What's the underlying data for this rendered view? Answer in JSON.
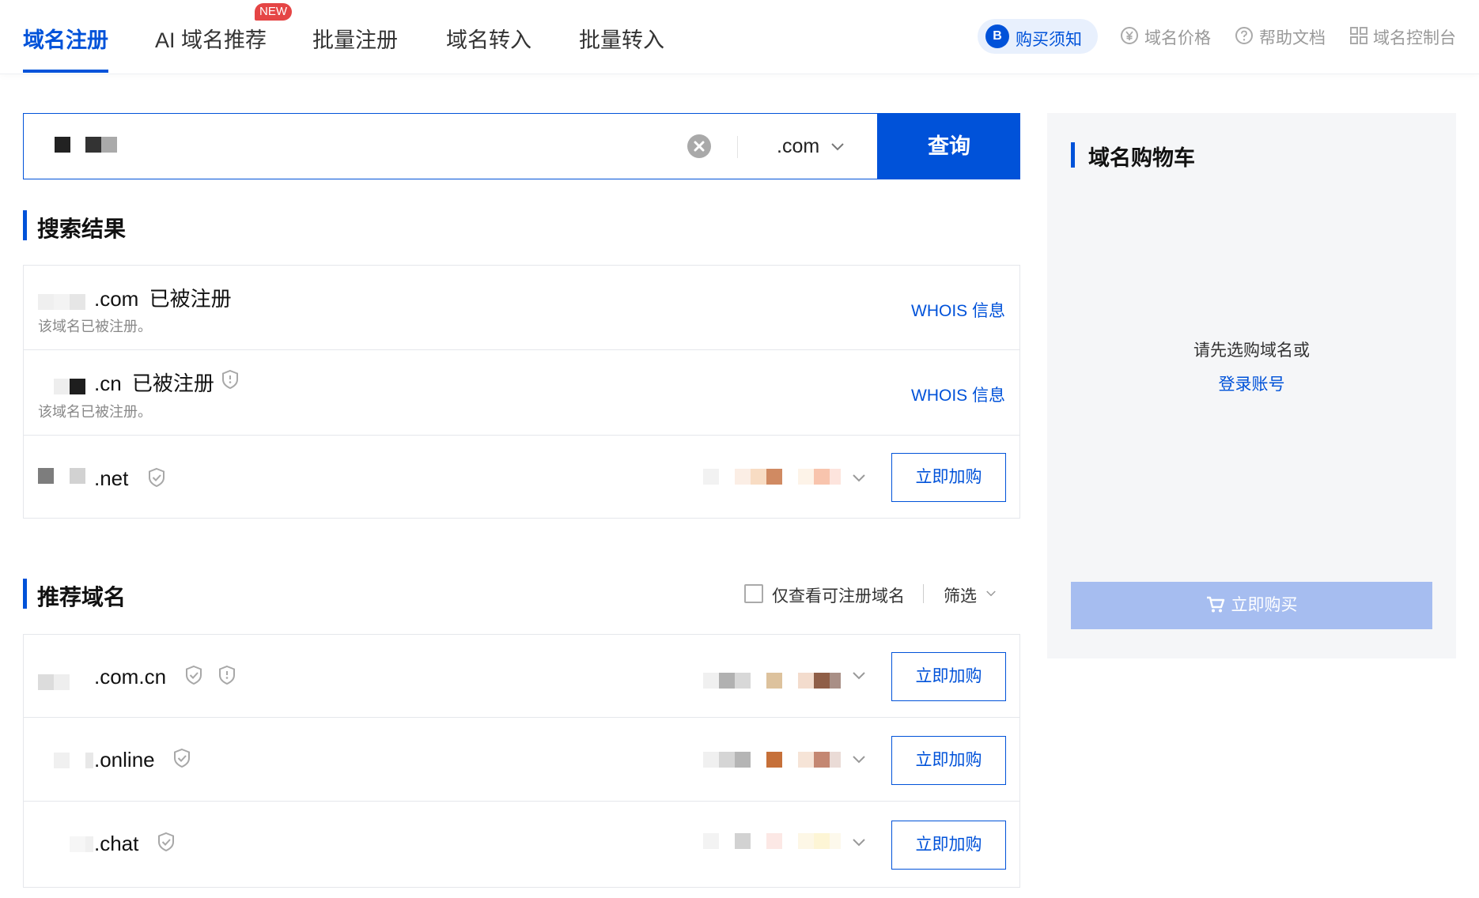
{
  "nav": {
    "tabs": [
      {
        "label": "域名注册",
        "active": true
      },
      {
        "label": "AI 域名推荐",
        "badge": "NEW"
      },
      {
        "label": "批量注册"
      },
      {
        "label": "域名转入"
      },
      {
        "label": "批量转入"
      }
    ],
    "links": [
      {
        "label": "购买须知",
        "icon": "notice-b-icon",
        "highlight": true
      },
      {
        "label": "域名价格",
        "icon": "yen-circle-icon"
      },
      {
        "label": "帮助文档",
        "icon": "question-circle-icon"
      },
      {
        "label": "域名控制台",
        "icon": "grid-icon"
      }
    ]
  },
  "search": {
    "query_obscured": true,
    "suffix": ".com",
    "button": "查询"
  },
  "results": {
    "title": "搜索结果",
    "rows": [
      {
        "suffix": ".com",
        "status": "已被注册",
        "note": "该域名已被注册。",
        "action": "WHOIS 信息",
        "shield": false
      },
      {
        "suffix": ".cn",
        "status": "已被注册",
        "note": "该域名已被注册。",
        "action": "WHOIS 信息",
        "shield": true
      },
      {
        "suffix": ".net",
        "action": "立即加购",
        "shield": true
      }
    ]
  },
  "recommend": {
    "title": "推荐域名",
    "filter_check_label": "仅查看可注册域名",
    "filter_label": "筛选",
    "rows": [
      {
        "suffix": ".com.cn",
        "action": "立即加购"
      },
      {
        "suffix": ".online",
        "action": "立即加购"
      },
      {
        "suffix": ".chat",
        "action": "立即加购"
      }
    ]
  },
  "cart": {
    "title": "域名购物车",
    "empty_text": "请先选购域名或",
    "login_link": "登录账号",
    "buy_button": "立即购买"
  },
  "colors": {
    "brand": "#0052d9",
    "badge_red": "#e54545",
    "cart_button_disabled": "#a6bdf0"
  }
}
